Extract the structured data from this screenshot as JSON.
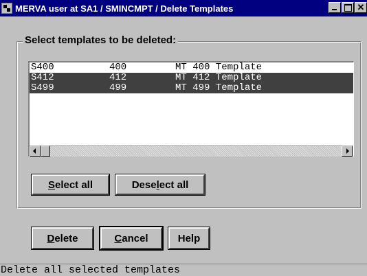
{
  "window": {
    "title": "MERVA user at SA1 / SMINCMPT /  Delete Templates"
  },
  "group": {
    "label": "Select templates to be deleted:"
  },
  "templates": [
    {
      "name": "S400",
      "number": "400",
      "description": "MT 400 Template",
      "selected": false
    },
    {
      "name": "S412",
      "number": "412",
      "description": "MT 412 Template",
      "selected": true
    },
    {
      "name": "S499",
      "number": "499",
      "description": "MT 499 Template",
      "selected": true
    }
  ],
  "buttons": {
    "select_all": {
      "mnemonic": "S",
      "rest": "elect all"
    },
    "deselect_all": {
      "pre": "Dese",
      "mnemonic": "l",
      "rest": "ect all"
    },
    "delete": {
      "mnemonic": "D",
      "rest": "elete"
    },
    "cancel": {
      "mnemonic": "C",
      "rest": "ancel"
    },
    "help": "Help"
  },
  "status": {
    "text": "Delete all selected templates"
  },
  "icons": {
    "system_menu": "app-system-icon",
    "minimize": "minimize-icon",
    "maximize": "maximize-icon",
    "close": "close-icon",
    "scroll_left": "arrow-left-icon",
    "scroll_right": "arrow-right-icon"
  },
  "colors": {
    "titlebar": "#000080",
    "selection": "#404040",
    "face": "#c0c0c0"
  }
}
